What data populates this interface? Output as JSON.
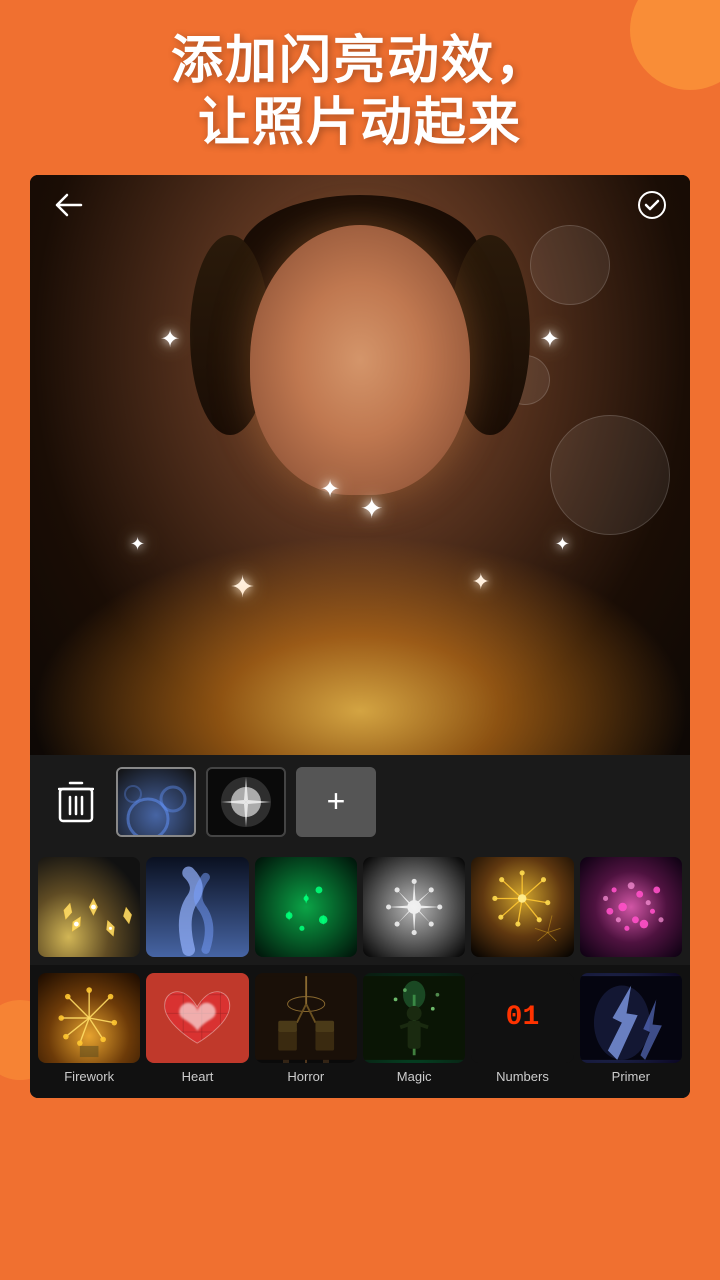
{
  "header": {
    "title_line1": "添加闪亮动效，",
    "title_line2": "让照片动起来"
  },
  "editor": {
    "back_icon": "←",
    "confirm_icon": "✓",
    "toolbar": {
      "trash_label": "🗑",
      "add_label": "+"
    }
  },
  "effects_grid": [
    {
      "id": "sparks",
      "style_class": "eff-sparks"
    },
    {
      "id": "smoke",
      "style_class": "eff-smoke"
    },
    {
      "id": "green-sparkle",
      "style_class": "eff-green-sparkle"
    },
    {
      "id": "white-burst",
      "style_class": "eff-white-burst"
    },
    {
      "id": "fireworks-gold",
      "style_class": "eff-fireworks"
    },
    {
      "id": "pink-scatter",
      "style_class": "eff-pink-scatter"
    }
  ],
  "categories": [
    {
      "id": "firework",
      "label": "Firework",
      "style_class": "cat-firework"
    },
    {
      "id": "heart",
      "label": "Heart",
      "style_class": "cat-heart",
      "icon": "❤"
    },
    {
      "id": "horror",
      "label": "Horror",
      "style_class": "horror-room"
    },
    {
      "id": "magic",
      "label": "Magic",
      "style_class": "magic-effect"
    },
    {
      "id": "numbers",
      "label": "Numbers",
      "style_class": "cat-numbers",
      "icon": "01"
    },
    {
      "id": "primer",
      "label": "Primer",
      "style_class": "primer-effect"
    }
  ]
}
